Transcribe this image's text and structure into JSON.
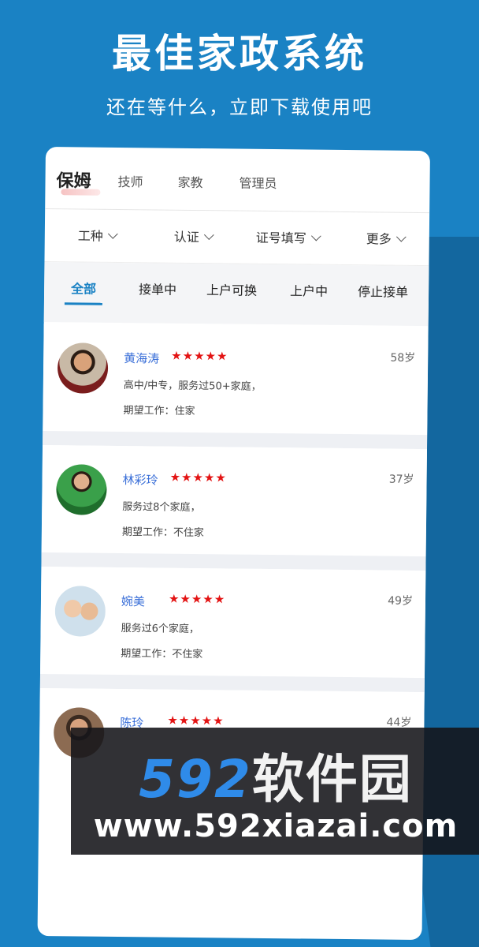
{
  "hero": {
    "title": "最佳家政系统",
    "subtitle": "还在等什么，立即下载使用吧"
  },
  "tabs": [
    {
      "label": "保姆",
      "active": true
    },
    {
      "label": "技师"
    },
    {
      "label": "家教"
    },
    {
      "label": "管理员"
    }
  ],
  "filters": [
    {
      "label": "工种"
    },
    {
      "label": "认证"
    },
    {
      "label": "证号填写"
    },
    {
      "label": "更多"
    }
  ],
  "status_tabs": [
    {
      "label": "全部",
      "active": true
    },
    {
      "label": "接单中"
    },
    {
      "label": "上户可换"
    },
    {
      "label": "上户中"
    },
    {
      "label": "停止接单"
    }
  ],
  "people": [
    {
      "name": "黄海涛",
      "stars": "★★★★★",
      "age": "58岁",
      "line1": "高中/中专，服务过50+家庭，",
      "line2": "期望工作：住家"
    },
    {
      "name": "林彩玲",
      "stars": "★★★★★",
      "age": "37岁",
      "line1": "服务过8个家庭，",
      "line2": "期望工作：不住家"
    },
    {
      "name": "婉美",
      "stars": "★★★★★",
      "age": "49岁",
      "line1": "服务过6个家庭，",
      "line2": "期望工作：不住家"
    },
    {
      "name": "陈玲",
      "stars": "★★★★★",
      "age": "44岁",
      "line1": "",
      "line2": ""
    }
  ],
  "watermark": {
    "brand_num": "592",
    "brand_cn": "软件园",
    "url": "www.592xiazai.com"
  },
  "colors": {
    "background": "#1a82c4",
    "accent": "#1a82c4",
    "star": "#e31313"
  }
}
